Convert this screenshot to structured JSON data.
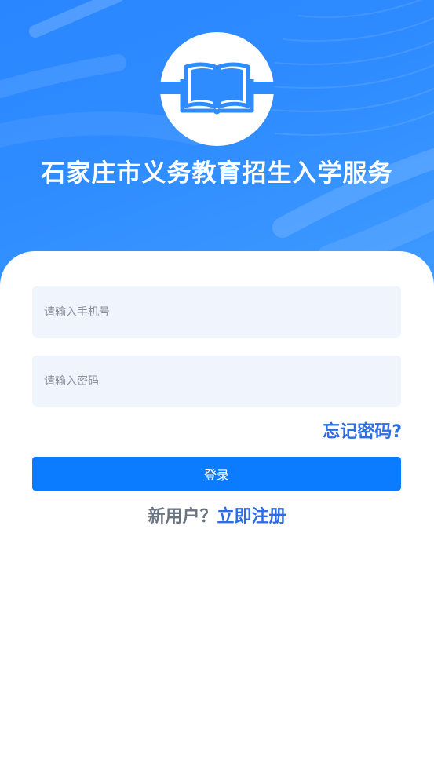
{
  "app": {
    "title": "石家庄市义务教育招生入学服务",
    "logo_icon": "open-book-icon"
  },
  "login_form": {
    "phone_placeholder": "请输入手机号",
    "password_placeholder": "请输入密码",
    "forgot_password_label": "忘记密码?",
    "login_label": "登录",
    "new_user_prompt": "新用户？",
    "register_label": "立即注册"
  },
  "colors": {
    "header_background": "#2f8cff",
    "accent_link": "#2b6de6",
    "primary_button": "#0b7cff",
    "input_background": "#eff4fd"
  }
}
